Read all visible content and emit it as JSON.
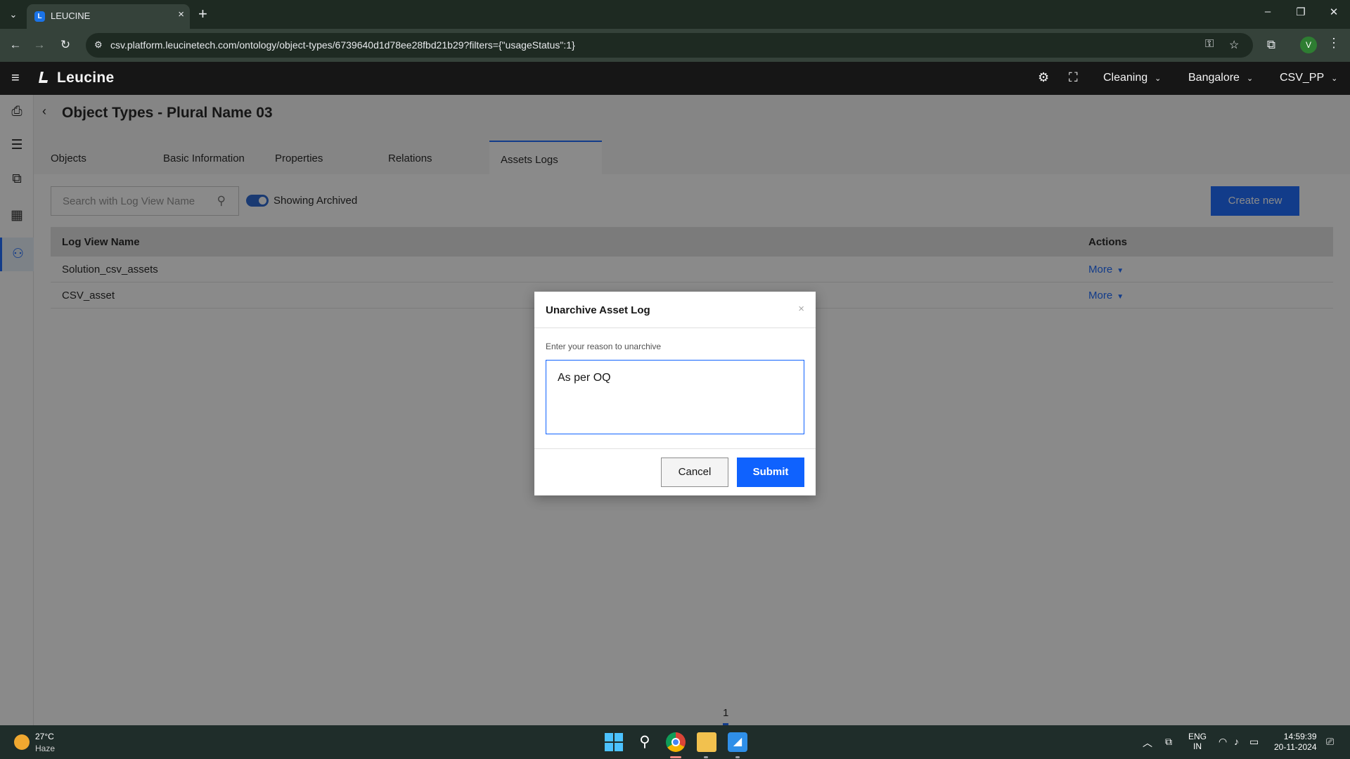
{
  "browser": {
    "tab_title": "LEUCINE",
    "tab_favicon_letter": "L",
    "url": "csv.platform.leucinetech.com/ontology/object-types/6739640d1d78ee28fbd21b29?filters={\"usageStatus\":1}",
    "profile_initial": "V"
  },
  "app": {
    "brand": "Leucine",
    "header_selects": {
      "facility_use": "Cleaning",
      "location": "Bangalore",
      "account": "CSV_PP"
    }
  },
  "page": {
    "title": "Object Types - Plural Name 03",
    "tabs": [
      {
        "label": "Objects"
      },
      {
        "label": "Basic Information"
      },
      {
        "label": "Properties"
      },
      {
        "label": "Relations"
      },
      {
        "label": "Assets Logs",
        "active": true
      }
    ]
  },
  "toolbar": {
    "search_placeholder": "Search with Log View Name",
    "toggle_label": "Showing Archived",
    "toggle_on": true,
    "create_label": "Create new"
  },
  "table": {
    "columns": [
      "Log View Name",
      "Actions"
    ],
    "rows": [
      {
        "name": "Solution_csv_assets",
        "action": "More"
      },
      {
        "name": "CSV_asset",
        "action": "More"
      }
    ]
  },
  "pagination": {
    "current_page": "1"
  },
  "modal": {
    "title": "Unarchive Asset Log",
    "close": "×",
    "field_label": "Enter your reason to unarchive",
    "field_value": "As per OQ",
    "cancel_label": "Cancel",
    "submit_label": "Submit"
  },
  "taskbar": {
    "temperature": "27°C",
    "weather": "Haze",
    "language_line1": "ENG",
    "language_line2": "IN",
    "time": "14:59:39",
    "date": "20-11-2024"
  },
  "colors": {
    "primary": "#0f62fe",
    "header_bg": "#161616",
    "browser_bg": "#35423a"
  },
  "icons": [
    "chevron-down-icon",
    "close-icon",
    "plus-icon",
    "back-arrow-icon",
    "forward-arrow-icon",
    "reload-icon",
    "site-info-icon",
    "password-key-icon",
    "bookmark-star-icon",
    "extensions-icon",
    "menu-kebab-icon",
    "hamburger-icon",
    "settings-icon",
    "scan-icon",
    "inbox-icon",
    "clipboard-icon",
    "flow-icon",
    "calendar-icon",
    "hierarchy-icon",
    "search-icon",
    "windows-start-icon",
    "chrome-icon",
    "file-explorer-icon",
    "app-icon",
    "wifi-icon",
    "volume-icon",
    "battery-icon",
    "notification-icon"
  ]
}
